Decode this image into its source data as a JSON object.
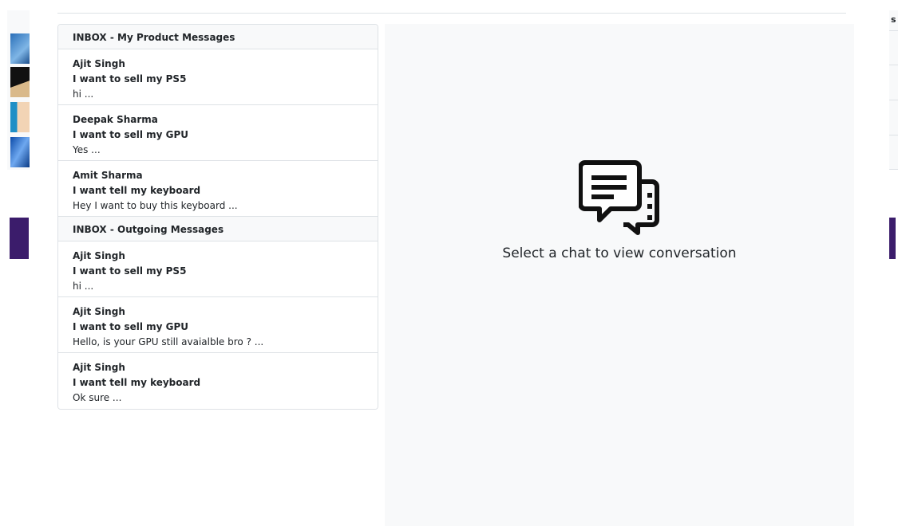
{
  "background": {
    "right_fragment_letter": "s"
  },
  "chat_list": {
    "sections": [
      {
        "title": "INBOX - My Product Messages",
        "chats": [
          {
            "name": "Ajit Singh",
            "subject": "I want to sell my PS5",
            "preview": "hi ..."
          },
          {
            "name": "Deepak Sharma",
            "subject": "I want to sell my GPU",
            "preview": "Yes ..."
          },
          {
            "name": "Amit Sharma",
            "subject": "I want tell my keyboard",
            "preview": "Hey I want to buy this keyboard ..."
          }
        ]
      },
      {
        "title": "INBOX - Outgoing Messages",
        "chats": [
          {
            "name": "Ajit Singh",
            "subject": "I want to sell my PS5",
            "preview": "hi ..."
          },
          {
            "name": "Ajit Singh",
            "subject": "I want to sell my GPU",
            "preview": "Hello, is your GPU still avaialble bro ? ..."
          },
          {
            "name": "Ajit Singh",
            "subject": "I want tell my keyboard",
            "preview": "Ok sure ..."
          }
        ]
      }
    ]
  },
  "conversation": {
    "icon": "chat-bubbles-icon",
    "empty_message": "Select a chat to view conversation"
  }
}
